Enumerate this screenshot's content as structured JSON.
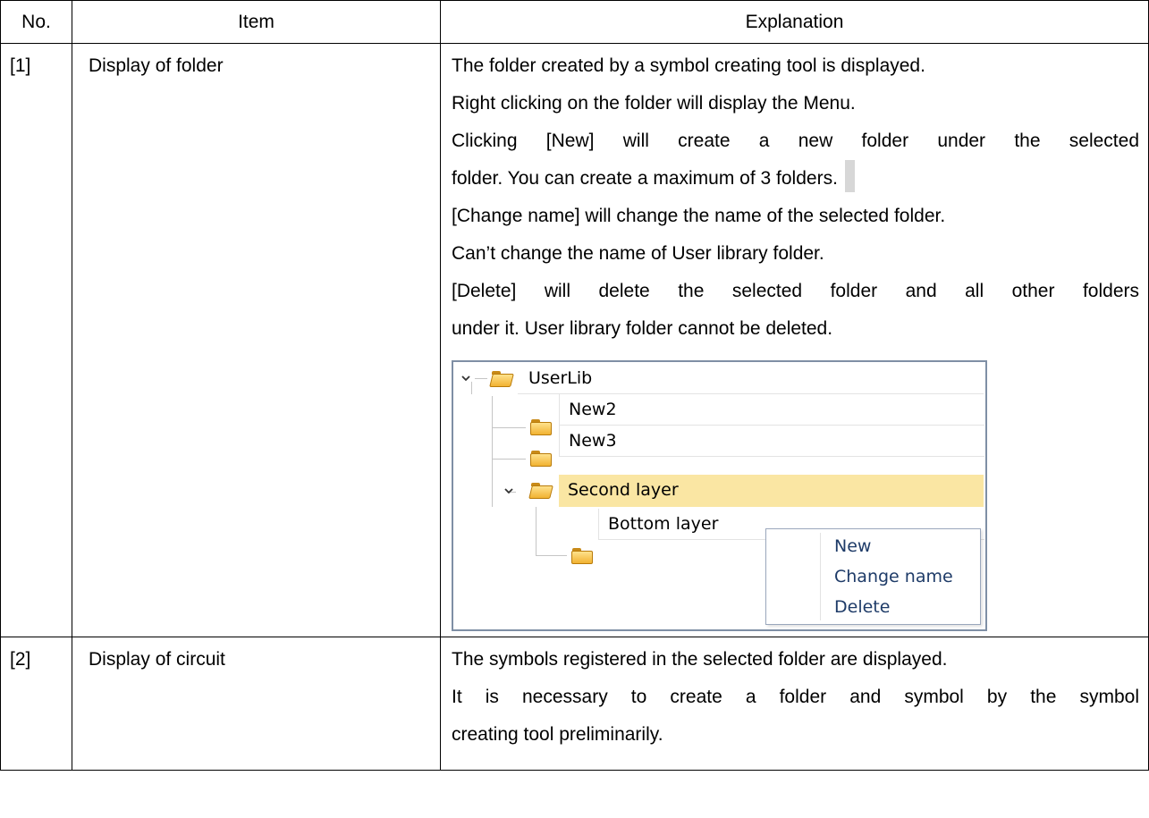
{
  "table": {
    "headers": {
      "no": "No.",
      "item": "Item",
      "explanation": "Explanation"
    },
    "rows": [
      {
        "no": "[1]",
        "item": "Display of folder",
        "lines": [
          "The folder created by a symbol creating tool is displayed.",
          "Right clicking on the folder will display the Menu.",
          "Clicking [New] will create a new folder under the selected",
          "folder. You can create a maximum of 3 folders.",
          "[Change name] will change the name of the selected folder.",
          "Can’t change the name of User library folder.",
          "[Delete] will delete the selected folder and all other folders",
          "under it. User library folder cannot be deleted."
        ]
      },
      {
        "no": "[2]",
        "item": "Display of circuit",
        "lines": [
          "The symbols registered in the selected folder are displayed.",
          "It is necessary to create a folder and symbol by the symbol",
          "creating tool preliminarily."
        ]
      }
    ]
  },
  "tree": {
    "nodes": [
      "UserLib",
      "New2",
      "New3",
      "Second layer",
      "Bottom layer"
    ],
    "selected": "Second layer",
    "context_menu": [
      "New",
      "Change name",
      "Delete"
    ],
    "colors": {
      "selection": "#fae6a3",
      "menu_text": "#1e3b68",
      "folder": "#f1b232",
      "border": "#7f8fa5"
    }
  }
}
